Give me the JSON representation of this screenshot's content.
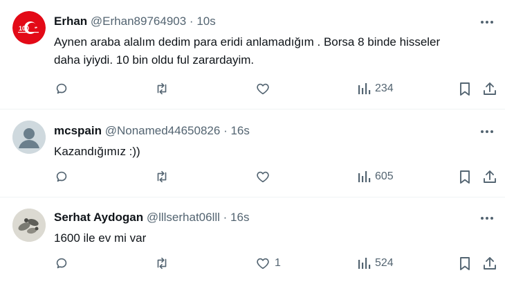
{
  "tweets": [
    {
      "display_name": "Erhan",
      "handle": "@Erhan89764903",
      "separator": "·",
      "time": "10s",
      "text_lines": [
        "Aynen araba alalım dedim para eridi anlamadığım . Borsa 8 binde hisseler",
        "daha iyiydi. 10 bin oldu ful zarardayim."
      ],
      "replies": "",
      "retweets": "",
      "likes": "",
      "views": "234",
      "avatar": "turkish-flag-logo-avatar"
    },
    {
      "display_name": "mcspain",
      "handle": "@Nonamed44650826",
      "separator": "·",
      "time": "16s",
      "text_lines": [
        "Kazandığımız :))"
      ],
      "replies": "",
      "retweets": "",
      "likes": "",
      "views": "605",
      "avatar": "default-profile-avatar"
    },
    {
      "display_name": "Serhat Aydogan",
      "handle": "@lllserhat06lll",
      "separator": "·",
      "time": "16s",
      "text_lines": [
        "1600 ile ev mi var"
      ],
      "replies": "",
      "retweets": "",
      "likes": "1",
      "views": "524",
      "avatar": "photo-avatar"
    }
  ],
  "icons": {
    "reply": "reply-icon",
    "retweet": "retweet-icon",
    "like": "like-icon",
    "views": "views-icon",
    "bookmark": "bookmark-icon",
    "share": "share-icon",
    "more": "more-icon"
  },
  "colors": {
    "text": "#0f1419",
    "muted": "#536471",
    "divider": "#eff3f4",
    "flag_red": "#e30a17"
  }
}
